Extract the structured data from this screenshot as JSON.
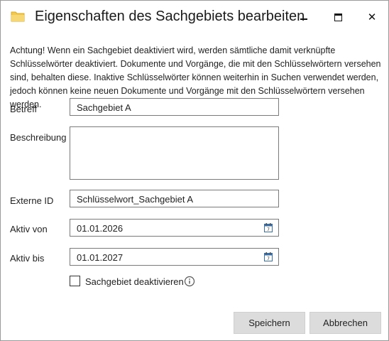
{
  "window": {
    "title": "Eigenschaften des Sachgebiets bearbeiten",
    "icon": "folder-icon",
    "controls": {
      "minimize": "—",
      "maximize": "□",
      "close": "✕"
    }
  },
  "message": "Achtung! Wenn ein Sachgebiet deaktiviert wird, werden sämtliche damit verknüpfte Schlüsselwörter deaktiviert. Dokumente und Vorgänge, die mit den Schlüsselwörtern versehen sind, behalten diese. Inaktive Schlüsselwörter können weiterhin in Suchen verwendet werden, jedoch können keine neuen Dokumente und Vorgänge mit den Schlüsselwörtern versehen werden.",
  "form": {
    "betreff": {
      "label": "Betreff",
      "value": "Sachgebiet A"
    },
    "beschreibung": {
      "label": "Beschreibung",
      "value": ""
    },
    "externe_id": {
      "label": "Externe ID",
      "value": "Schlüsselwort_Sachgebiet A"
    },
    "aktiv_von": {
      "label": "Aktiv von",
      "value": "01.01.2026",
      "icon": "calendar-icon"
    },
    "aktiv_bis": {
      "label": "Aktiv bis",
      "value": "01.01.2027",
      "icon": "calendar-icon"
    },
    "deaktivieren": {
      "label": "Sachgebiet deaktivieren",
      "checked": false,
      "icon": "info-icon"
    }
  },
  "buttons": {
    "save": "Speichern",
    "cancel": "Abbrechen"
  },
  "colors": {
    "folder": "#f2c94c",
    "button_bg": "#dcdcdc",
    "border": "#7a7a7a",
    "calendar_accent": "#3b6ea5"
  }
}
